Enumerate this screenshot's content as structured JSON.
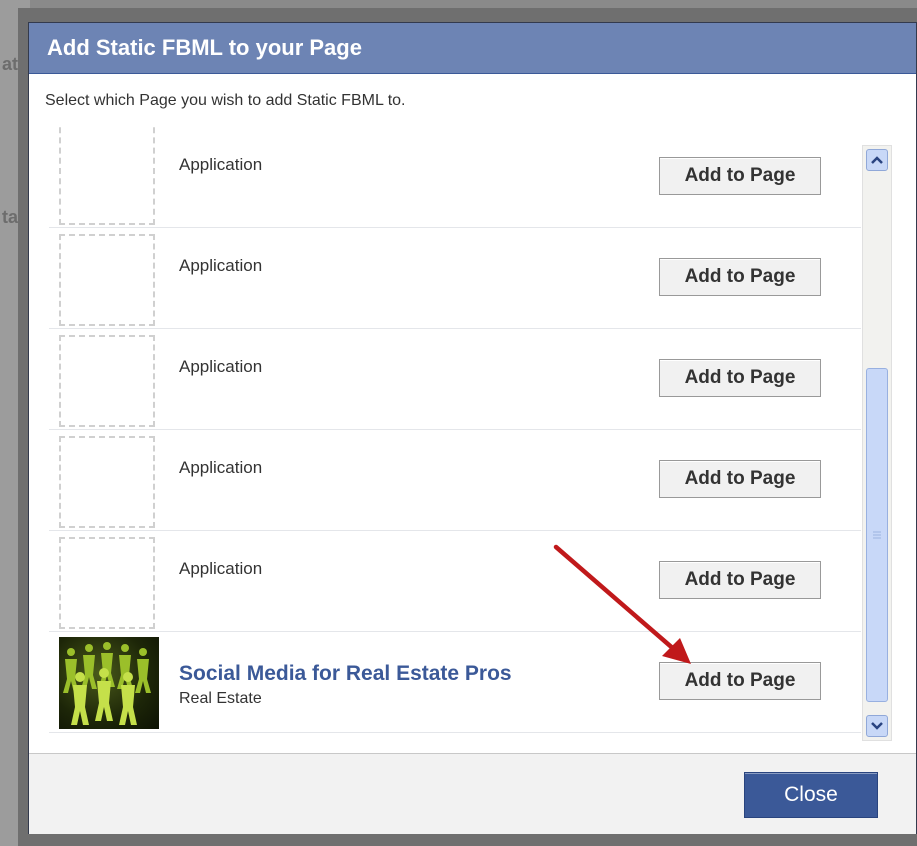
{
  "background": {
    "fragments": [
      "at",
      "ta"
    ]
  },
  "dialog": {
    "title": "Add Static FBML to your Page",
    "subtitle": "Select which Page you wish to add Static FBML to.",
    "rows": [
      {
        "label": "Application",
        "button": "Add to Page"
      },
      {
        "label": "Application",
        "button": "Add to Page"
      },
      {
        "label": "Application",
        "button": "Add to Page"
      },
      {
        "label": "Application",
        "button": "Add to Page"
      },
      {
        "label": "Application",
        "button": "Add to Page"
      }
    ],
    "page_row": {
      "name": "Social Media for Real Estate Pros",
      "category": "Real Estate",
      "button": "Add to Page"
    },
    "close_label": "Close"
  },
  "colors": {
    "title_bar": "#6d84b4",
    "link_blue": "#3b5998",
    "annotation_arrow": "#c0191b"
  },
  "icons": {
    "scroll_up": "chevron-up-icon",
    "scroll_down": "chevron-down-icon",
    "annotation": "red-arrow-icon"
  }
}
